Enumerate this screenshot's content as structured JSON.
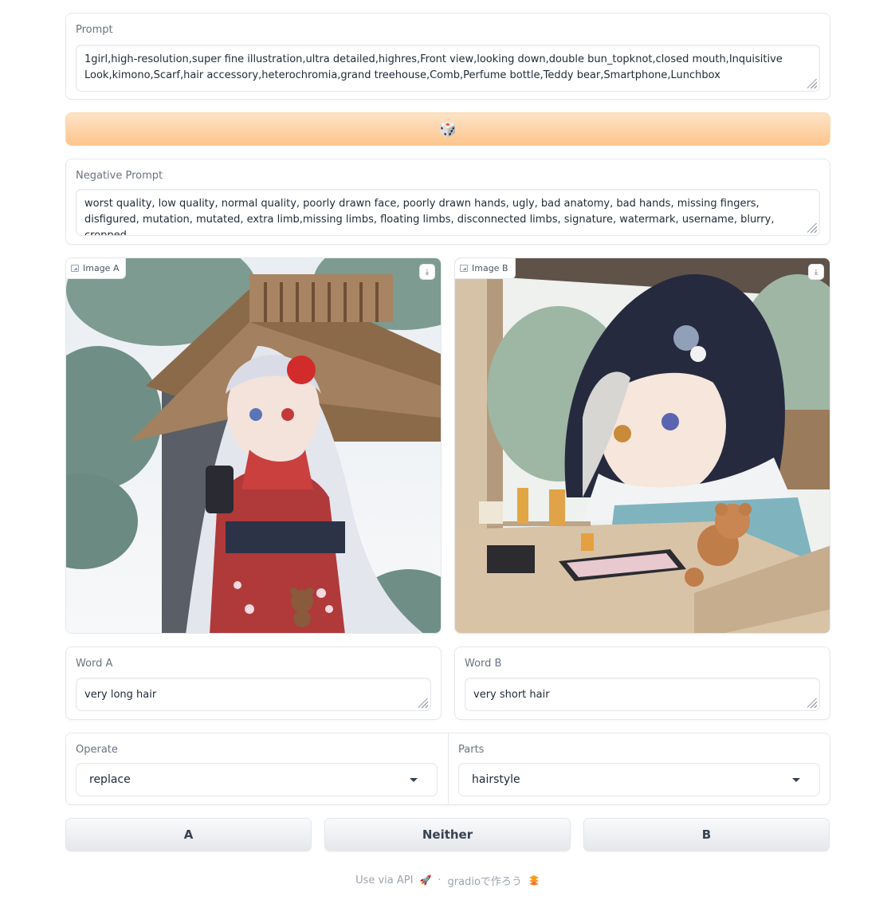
{
  "prompt": {
    "label": "Prompt",
    "value": "1girl,high-resolution,super fine illustration,ultra detailed,highres,Front view,looking down,double bun_topknot,closed mouth,Inquisitive Look,kimono,Scarf,hair accessory,heterochromia,grand treehouse,Comb,Perfume bottle,Teddy bear,Smartphone,Lunchbox"
  },
  "random_button": {
    "icon": "🎲"
  },
  "negative_prompt": {
    "label": "Negative Prompt",
    "value": "worst quality, low quality, normal quality, poorly drawn face, poorly drawn hands, ugly, bad anatomy, bad hands, missing fingers, disfigured, mutation, mutated, extra limb,missing limbs, floating limbs, disconnected limbs, signature, watermark, username, blurry, cropped"
  },
  "image_a": {
    "label": "Image A",
    "icon": "image-icon",
    "download_icon": "download-icon"
  },
  "image_b": {
    "label": "Image B",
    "icon": "image-icon",
    "download_icon": "download-icon"
  },
  "word_a": {
    "label": "Word A",
    "value": "very long hair"
  },
  "word_b": {
    "label": "Word B",
    "value": "very short hair"
  },
  "operate": {
    "label": "Operate",
    "value": "replace"
  },
  "parts": {
    "label": "Parts",
    "value": "hairstyle"
  },
  "votes": {
    "a": "A",
    "neither": "Neither",
    "b": "B"
  },
  "footer": {
    "api_text": "Use via API",
    "api_icon": "🚀",
    "separator": "·",
    "built_text": "gradioで作ろう",
    "built_icon": "logo-icon"
  }
}
